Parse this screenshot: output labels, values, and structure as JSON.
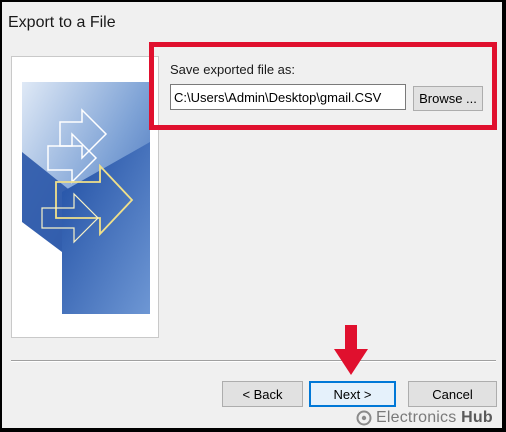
{
  "dialog": {
    "title": "Export to a File"
  },
  "save_as": {
    "label": "Save exported file as:",
    "path_value": "C:\\Users\\Admin\\Desktop\\gmail.CSV",
    "browse_label": "Browse ..."
  },
  "buttons": {
    "back_label": "< Back",
    "next_label": "Next >",
    "cancel_label": "Cancel"
  },
  "watermark": {
    "text_light": "Electronics",
    "text_bold": "Hub"
  },
  "colors": {
    "highlight": "#e0102e",
    "focus_border": "#0078d7",
    "dialog_bg": "#f0f0f0"
  },
  "icons": [
    "wizard-graphic-icon",
    "red-down-arrow-icon",
    "electronicshub-logo-icon"
  ]
}
